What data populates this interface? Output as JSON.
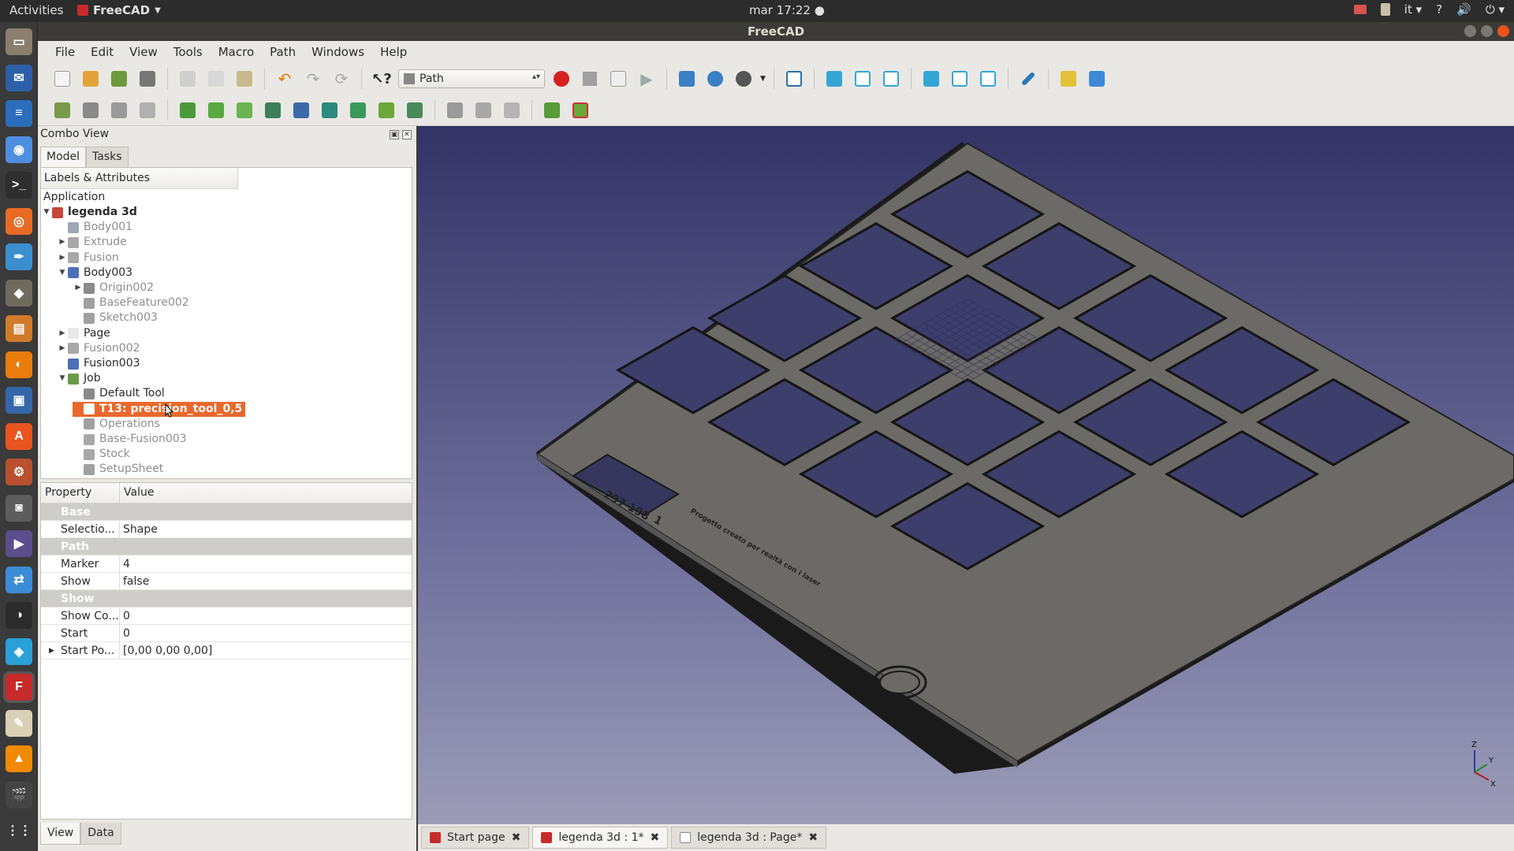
{
  "topbar": {
    "activities": "Activities",
    "app_name": "FreeCAD",
    "clock": "mar 17:22",
    "lang": "it",
    "help": "?"
  },
  "dock": {
    "items": [
      {
        "name": "files-icon",
        "color": "#8a7f6e"
      },
      {
        "name": "thunderbird-icon",
        "color": "#2d5fa8"
      },
      {
        "name": "writer-icon",
        "color": "#2a6ebb"
      },
      {
        "name": "chromium-icon",
        "color": "#4e8ee0"
      },
      {
        "name": "terminal-icon",
        "color": "#2e2e2e"
      },
      {
        "name": "firefox-icon",
        "color": "#e76a25"
      },
      {
        "name": "inkscape-icon",
        "color": "#3b8fcf"
      },
      {
        "name": "gimp-icon",
        "color": "#6f6a5e"
      },
      {
        "name": "impress-icon",
        "color": "#d17a2a"
      },
      {
        "name": "blender-icon",
        "color": "#e87d0d"
      },
      {
        "name": "virtualbox-icon",
        "color": "#3567a8"
      },
      {
        "name": "software-center-icon",
        "color": "#e95420"
      },
      {
        "name": "settings-icon",
        "color": "#b9502e"
      },
      {
        "name": "camera-icon",
        "color": "#5d5d5d"
      },
      {
        "name": "video-editor-icon",
        "color": "#5a4e8c"
      },
      {
        "name": "network-icon",
        "color": "#3b8cd6"
      },
      {
        "name": "remote-icon",
        "color": "#2b2b2b"
      },
      {
        "name": "cura-icon",
        "color": "#2aa0d8"
      },
      {
        "name": "freecad-icon",
        "color": "#c72a2a"
      },
      {
        "name": "text-editor-icon",
        "color": "#d9d0b6"
      },
      {
        "name": "vlc-icon",
        "color": "#f08a00"
      },
      {
        "name": "clapperboard-icon",
        "color": "#444"
      },
      {
        "name": "show-apps-icon",
        "color": "#3a3a3a"
      }
    ]
  },
  "window": {
    "title": "FreeCAD"
  },
  "menubar": [
    "File",
    "Edit",
    "View",
    "Tools",
    "Macro",
    "Path",
    "Windows",
    "Help"
  ],
  "toolbar": {
    "workbench": "Path"
  },
  "combo": {
    "title": "Combo View",
    "tabs": [
      "Model",
      "Tasks"
    ],
    "bottom_tabs": [
      "View",
      "Data"
    ]
  },
  "tree": {
    "header": "Labels & Attributes",
    "root": "Application",
    "items": [
      {
        "label": "legenda 3d",
        "level": 0,
        "expander": "open",
        "icon": "document-icon",
        "color": "#c8453a",
        "style": "bold"
      },
      {
        "label": "Body001",
        "level": 1,
        "expander": "",
        "icon": "body-icon",
        "color": "#9ea7b8",
        "style": "dim"
      },
      {
        "label": "Extrude",
        "level": 1,
        "expander": "closed",
        "icon": "extrude-icon",
        "color": "#a8a8a8",
        "style": "dim"
      },
      {
        "label": "Fusion",
        "level": 1,
        "expander": "closed",
        "icon": "fusion-icon",
        "color": "#a8a8a8",
        "style": "dim"
      },
      {
        "label": "Body003",
        "level": 1,
        "expander": "open",
        "icon": "body-icon",
        "color": "#4d6fb8",
        "style": "normal"
      },
      {
        "label": "Origin002",
        "level": 2,
        "expander": "closed",
        "icon": "origin-icon",
        "color": "#8a8a8a",
        "style": "dim"
      },
      {
        "label": "BaseFeature002",
        "level": 2,
        "expander": "",
        "icon": "basefeature-icon",
        "color": "#a0a0a0",
        "style": "dim"
      },
      {
        "label": "Sketch003",
        "level": 2,
        "expander": "",
        "icon": "sketch-icon",
        "color": "#a0a0a0",
        "style": "dim"
      },
      {
        "label": "Page",
        "level": 1,
        "expander": "closed",
        "icon": "page-icon",
        "color": "#e8e8e8",
        "style": "normal"
      },
      {
        "label": "Fusion002",
        "level": 1,
        "expander": "closed",
        "icon": "fusion-icon",
        "color": "#a8a8a8",
        "style": "dim"
      },
      {
        "label": "Fusion003",
        "level": 1,
        "expander": "",
        "icon": "fusion-icon",
        "color": "#4d6fb8",
        "style": "normal"
      },
      {
        "label": "Job",
        "level": 1,
        "expander": "open",
        "icon": "job-icon",
        "color": "#6b9a4a",
        "style": "normal"
      },
      {
        "label": "Default Tool",
        "level": 2,
        "expander": "",
        "icon": "tool-icon",
        "color": "#8a8a8a",
        "style": "normal"
      },
      {
        "label": "T13: precision_tool_0,5",
        "level": 2,
        "expander": "",
        "icon": "tool-icon",
        "color": "#ffffff",
        "style": "selected"
      },
      {
        "label": "Operations",
        "level": 2,
        "expander": "",
        "icon": "operations-icon",
        "color": "#a0a0a0",
        "style": "dim"
      },
      {
        "label": "Base-Fusion003",
        "level": 2,
        "expander": "",
        "icon": "fusion-icon",
        "color": "#a8a8a8",
        "style": "dim"
      },
      {
        "label": "Stock",
        "level": 2,
        "expander": "",
        "icon": "stock-icon",
        "color": "#a8a8a8",
        "style": "dim"
      },
      {
        "label": "SetupSheet",
        "level": 2,
        "expander": "",
        "icon": "setupsheet-icon",
        "color": "#a0a0a0",
        "style": "dim"
      }
    ]
  },
  "properties": {
    "headers": [
      "Property",
      "Value"
    ],
    "rows": [
      {
        "type": "group",
        "name": "Base"
      },
      {
        "type": "prop",
        "name": "Selectio...",
        "value": "Shape"
      },
      {
        "type": "group",
        "name": "Path"
      },
      {
        "type": "prop",
        "name": "Marker S...",
        "value": "4"
      },
      {
        "type": "prop",
        "name": "Show No...",
        "value": "false"
      },
      {
        "type": "group",
        "name": "Show"
      },
      {
        "type": "prop",
        "name": "Show Co...",
        "value": "0"
      },
      {
        "type": "prop",
        "name": "Start Index",
        "value": "0"
      },
      {
        "type": "prop",
        "name": "Start Po...",
        "value": "[0,00 0,00 0,00]",
        "expandable": true
      }
    ]
  },
  "viewport": {
    "plate_text": [
      "297",
      "198",
      "1"
    ],
    "plate_note": "Progetto creato per realtà con i laser",
    "axis_labels": [
      "Z",
      "Y",
      "X"
    ]
  },
  "documents": [
    {
      "label": "Start page",
      "icon": "freecad-icon",
      "active": false
    },
    {
      "label": "legenda 3d : 1*",
      "icon": "freecad-icon",
      "active": true
    },
    {
      "label": "legenda 3d : Page*",
      "icon": "page-icon",
      "active": false
    }
  ]
}
